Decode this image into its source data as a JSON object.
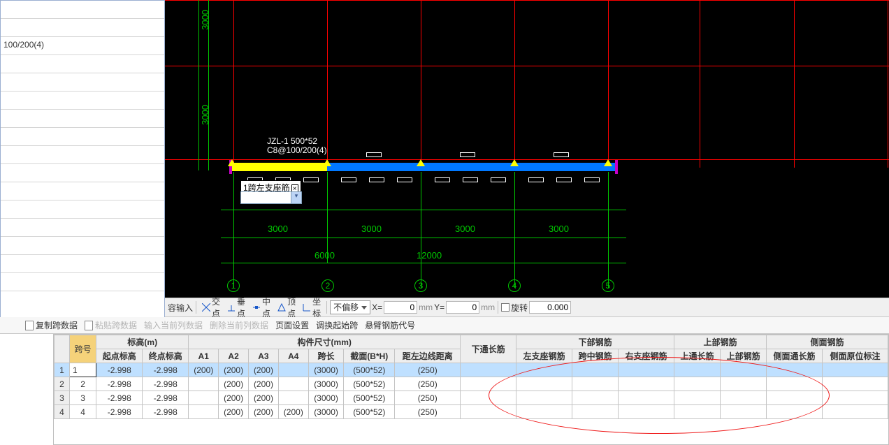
{
  "leftPanel": {
    "rows": [
      "",
      "",
      "100/200(4)",
      "",
      "",
      "",
      "",
      "",
      "",
      "",
      "",
      "",
      "",
      "",
      "",
      "",
      ""
    ]
  },
  "viewport": {
    "beam_label_1": "JZL-1 500*52",
    "beam_label_2": "C8@100/200(4)",
    "input_text": "1跨左支座筋",
    "dims_h": [
      "3000",
      "3000",
      "3000",
      "3000"
    ],
    "dims_big": [
      "6000",
      "12000"
    ],
    "axes": [
      "1",
      "2",
      "3",
      "4",
      "5"
    ],
    "dim_v": "3000"
  },
  "snap": {
    "items": [
      "交点",
      "垂点",
      "中点",
      "顶点",
      "坐标"
    ],
    "combo": "不偏移",
    "x_lbl": "X=",
    "y_lbl": "Y=",
    "mm": "mm",
    "rot_cb": "旋转",
    "rot_val": "0.000",
    "x_val": "0",
    "y_val": "0",
    "suffix": "容输入"
  },
  "dataBar": {
    "copy": "复制跨数据",
    "paste": "粘贴跨数据",
    "in": "输入当前列数据",
    "del": "删除当前列数据",
    "page": "页面设置",
    "swap": "调换起始跨",
    "code": "悬臂钢筋代号"
  },
  "grid": {
    "group_kh": "跨号",
    "group_elev": "标高(m)",
    "elev_a": "起点标高",
    "elev_b": "终点标高",
    "group_size": "构件尺寸(mm)",
    "a1": "A1",
    "a2": "A2",
    "a3": "A3",
    "a4": "A4",
    "span": "跨长",
    "sect": "截面(B*H)",
    "edge": "距左边线距离",
    "group_top": "下通长筋",
    "group_bot": "下部钢筋",
    "b1": "左支座钢筋",
    "b2": "跨中钢筋",
    "b3": "右支座钢筋",
    "group_up": "上部钢筋",
    "u1": "上通长筋",
    "u2": "上部钢筋",
    "group_side": "侧面钢筋",
    "s1": "侧面通长筋",
    "s2": "侧面原位标注",
    "rows": [
      {
        "k": "1",
        "ea": "-2.998",
        "eb": "-2.998",
        "a1": "(200)",
        "a2": "(200)",
        "a3": "(200)",
        "a4": "",
        "span": "(3000)",
        "sect": "(500*52)",
        "edge": "(250)"
      },
      {
        "k": "2",
        "ea": "-2.998",
        "eb": "-2.998",
        "a1": "",
        "a2": "(200)",
        "a3": "(200)",
        "a4": "",
        "span": "(3000)",
        "sect": "(500*52)",
        "edge": "(250)"
      },
      {
        "k": "3",
        "ea": "-2.998",
        "eb": "-2.998",
        "a1": "",
        "a2": "(200)",
        "a3": "(200)",
        "a4": "",
        "span": "(3000)",
        "sect": "(500*52)",
        "edge": "(250)"
      },
      {
        "k": "4",
        "ea": "-2.998",
        "eb": "-2.998",
        "a1": "",
        "a2": "(200)",
        "a3": "(200)",
        "a4": "(200)",
        "span": "(3000)",
        "sect": "(500*52)",
        "edge": "(250)"
      }
    ]
  }
}
